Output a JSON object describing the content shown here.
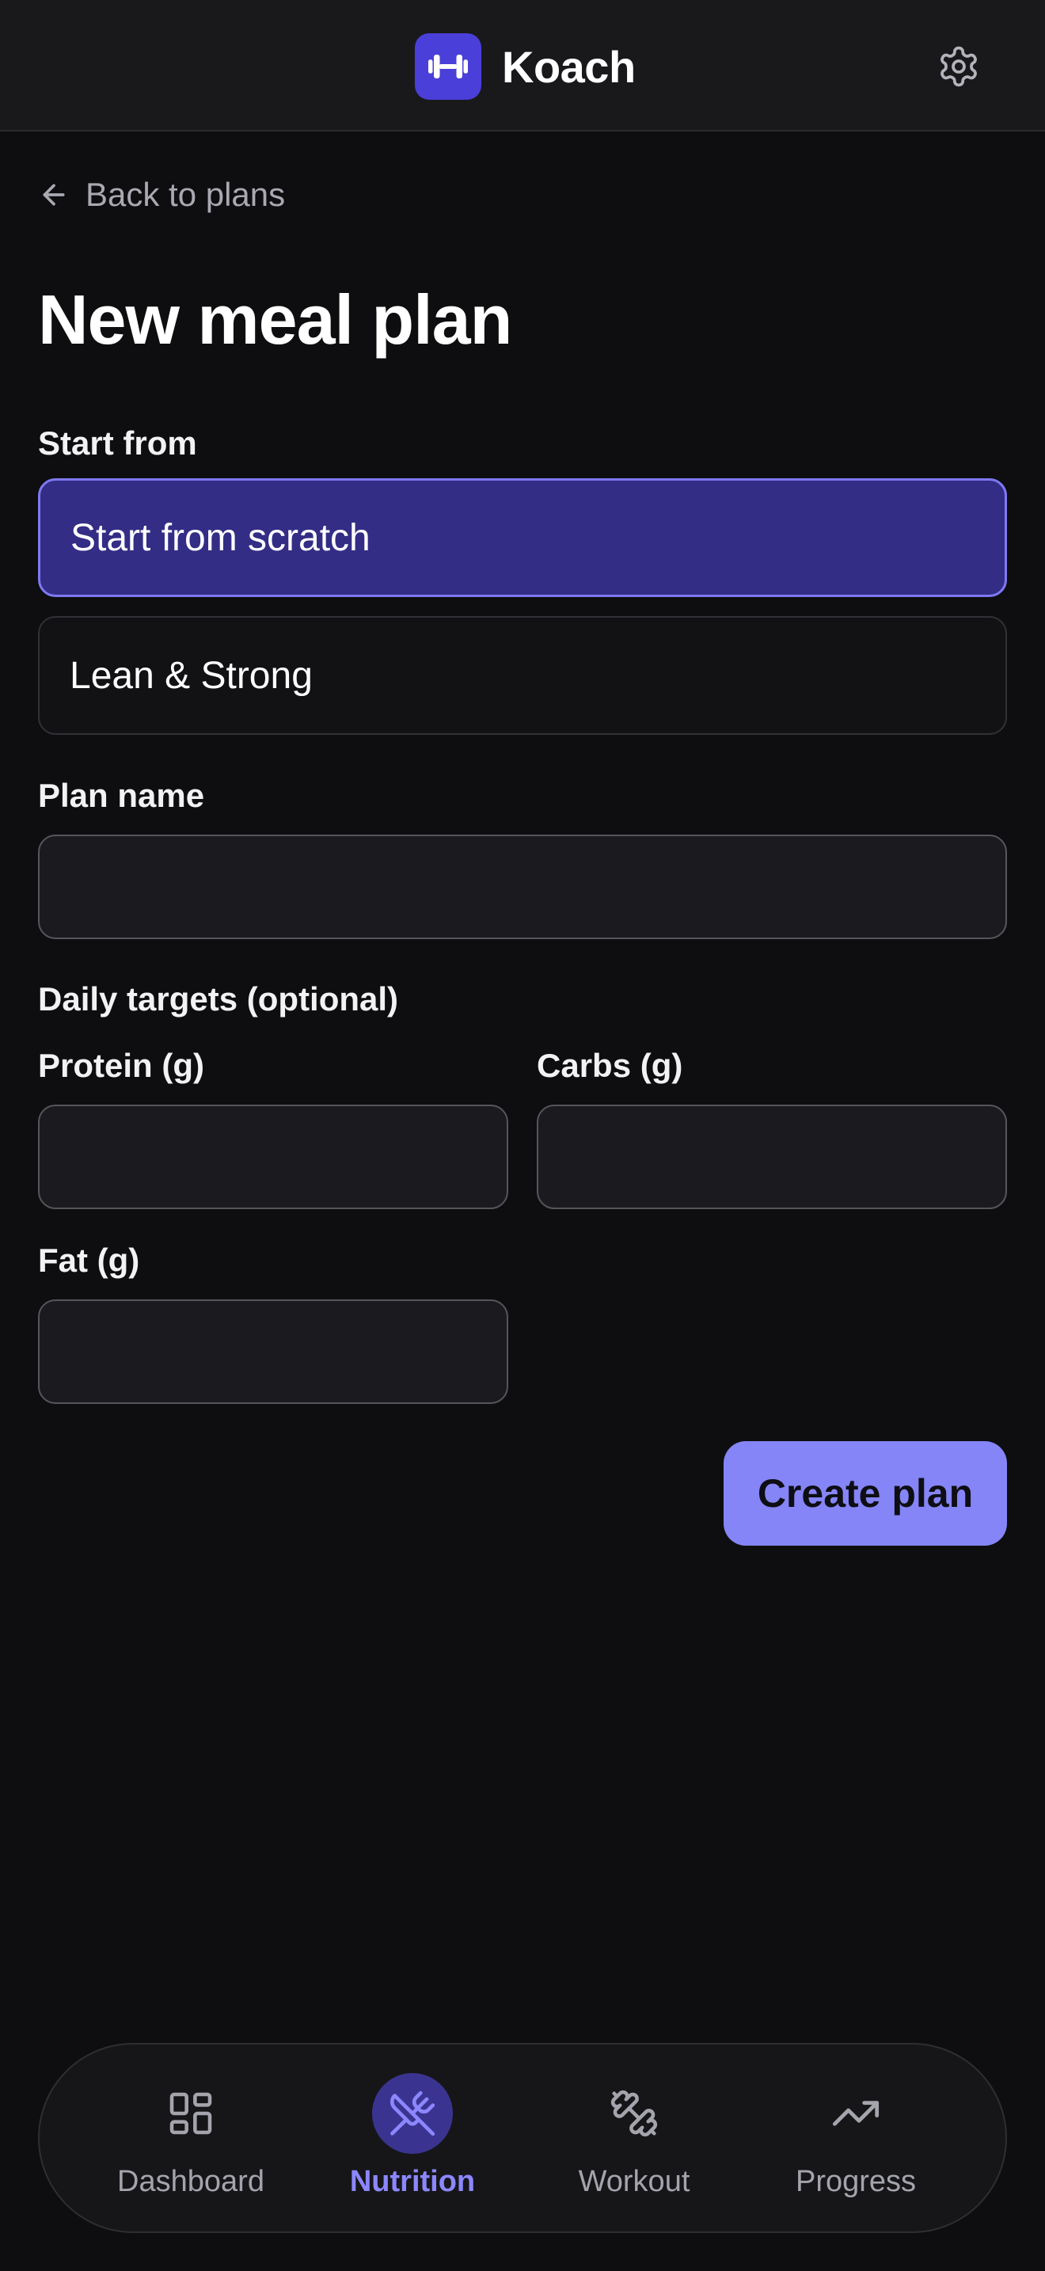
{
  "header": {
    "app_name": "Koach",
    "logo_icon": "dumbbell-icon",
    "settings_icon": "gear-icon",
    "logo_color": "#4a3fd8"
  },
  "back_link": {
    "label": "Back to plans",
    "icon": "arrow-left-icon"
  },
  "page": {
    "title": "New meal plan"
  },
  "start_from": {
    "label": "Start from",
    "options": [
      {
        "label": "Start from scratch",
        "selected": true
      },
      {
        "label": "Lean & Strong",
        "selected": false
      }
    ]
  },
  "plan_name": {
    "label": "Plan name",
    "value": "",
    "placeholder": ""
  },
  "daily_targets": {
    "label": "Daily targets (optional)",
    "protein": {
      "label": "Protein (g)",
      "value": ""
    },
    "carbs": {
      "label": "Carbs (g)",
      "value": ""
    },
    "fat": {
      "label": "Fat (g)",
      "value": ""
    }
  },
  "create_button": {
    "label": "Create plan",
    "color": "#8585f7"
  },
  "bottom_nav": {
    "items": [
      {
        "label": "Dashboard",
        "icon": "grid-icon",
        "active": false
      },
      {
        "label": "Nutrition",
        "icon": "utensils-icon",
        "active": true
      },
      {
        "label": "Workout",
        "icon": "dumbbell-icon",
        "active": false
      },
      {
        "label": "Progress",
        "icon": "trending-up-icon",
        "active": false
      }
    ],
    "active_color": "#8c87ff"
  }
}
